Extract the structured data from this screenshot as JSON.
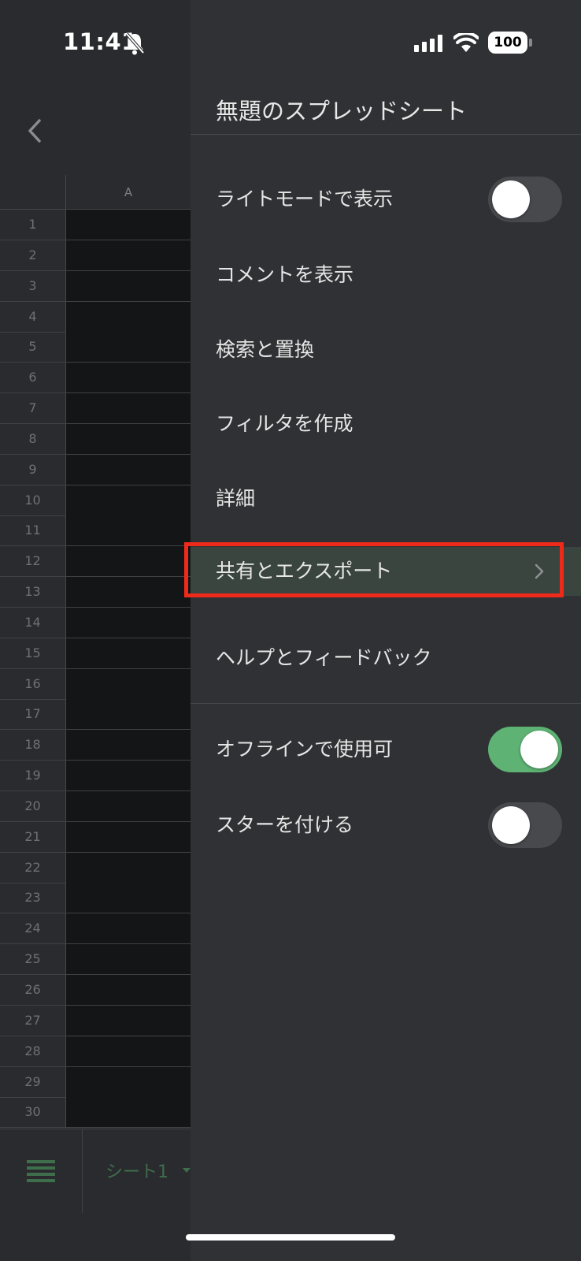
{
  "status_bar": {
    "time": "11:41",
    "battery": "100"
  },
  "sheet": {
    "column_header": "A",
    "rows": [
      "1",
      "2",
      "3",
      "4",
      "5",
      "6",
      "7",
      "8",
      "9",
      "10",
      "11",
      "12",
      "13",
      "14",
      "15",
      "16",
      "17",
      "18",
      "19",
      "20",
      "21",
      "22",
      "23",
      "24",
      "25",
      "26",
      "27",
      "28",
      "29",
      "30"
    ],
    "active_tab": "シート1"
  },
  "drawer": {
    "title": "無題のスプレッドシート",
    "items": [
      {
        "label": "ライトモードで表示",
        "toggle": false
      },
      {
        "label": "コメントを表示"
      },
      {
        "label": "検索と置換"
      },
      {
        "label": "フィルタを作成"
      },
      {
        "label": "詳細"
      },
      {
        "label": "共有とエクスポート",
        "highlighted": true,
        "chevron": true
      },
      {
        "label": "ヘルプとフィードバック"
      },
      {
        "label": "オフラインで使用可",
        "toggle": true
      },
      {
        "label": "スターを付ける",
        "toggle": false
      }
    ]
  },
  "colors": {
    "toggle_on": "#5db274",
    "toggle_off": "#48494d",
    "highlight_border": "#ee2a1b",
    "drawer_bg": "#303134"
  }
}
